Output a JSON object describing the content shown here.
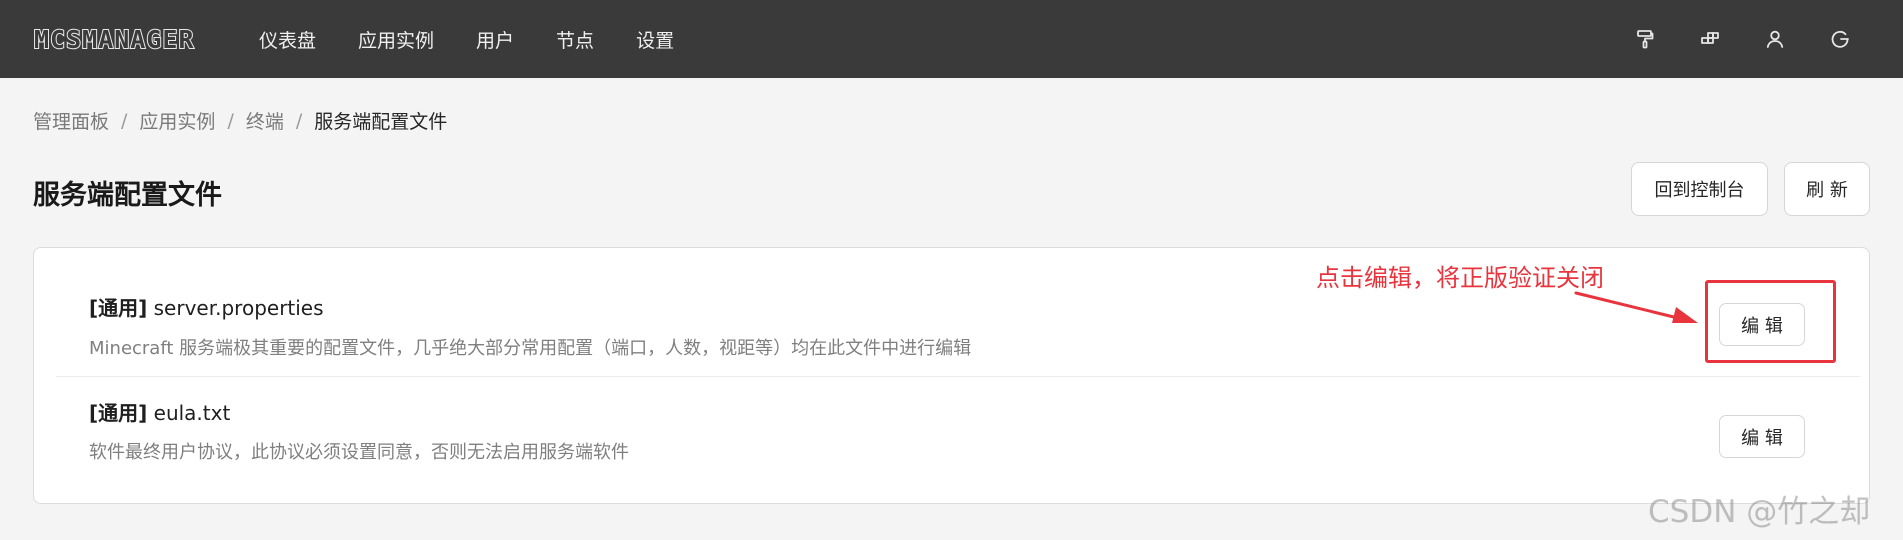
{
  "app": {
    "logo_text": "MCSMANAGER"
  },
  "nav": {
    "items": [
      "仪表盘",
      "应用实例",
      "用户",
      "节点",
      "设置"
    ]
  },
  "top_icons": [
    "paint-roller-icon",
    "layout-blocks-icon",
    "user-icon",
    "logout-icon"
  ],
  "breadcrumb": {
    "items": [
      "管理面板",
      "应用实例",
      "终端",
      "服务端配置文件"
    ],
    "separator": "/"
  },
  "page": {
    "title": "服务端配置文件",
    "back_button": "回到控制台",
    "refresh_button": "刷 新"
  },
  "files": [
    {
      "tag": "[通用]",
      "name": "server.properties",
      "description": "Minecraft 服务端极其重要的配置文件，几乎绝大部分常用配置（端口，人数，视距等）均在此文件中进行编辑",
      "edit_label": "编 辑"
    },
    {
      "tag": "[通用]",
      "name": "eula.txt",
      "description": "软件最终用户协议，此协议必须设置同意，否则无法启用服务端软件",
      "edit_label": "编 辑"
    }
  ],
  "annotation": {
    "text": "点击编辑，将正版验证关闭",
    "color": "#e8343c"
  },
  "watermark": "CSDN @竹之却",
  "colors": {
    "topbar": "#3a3a3a",
    "background": "#f4f4f4",
    "card": "#ffffff"
  }
}
